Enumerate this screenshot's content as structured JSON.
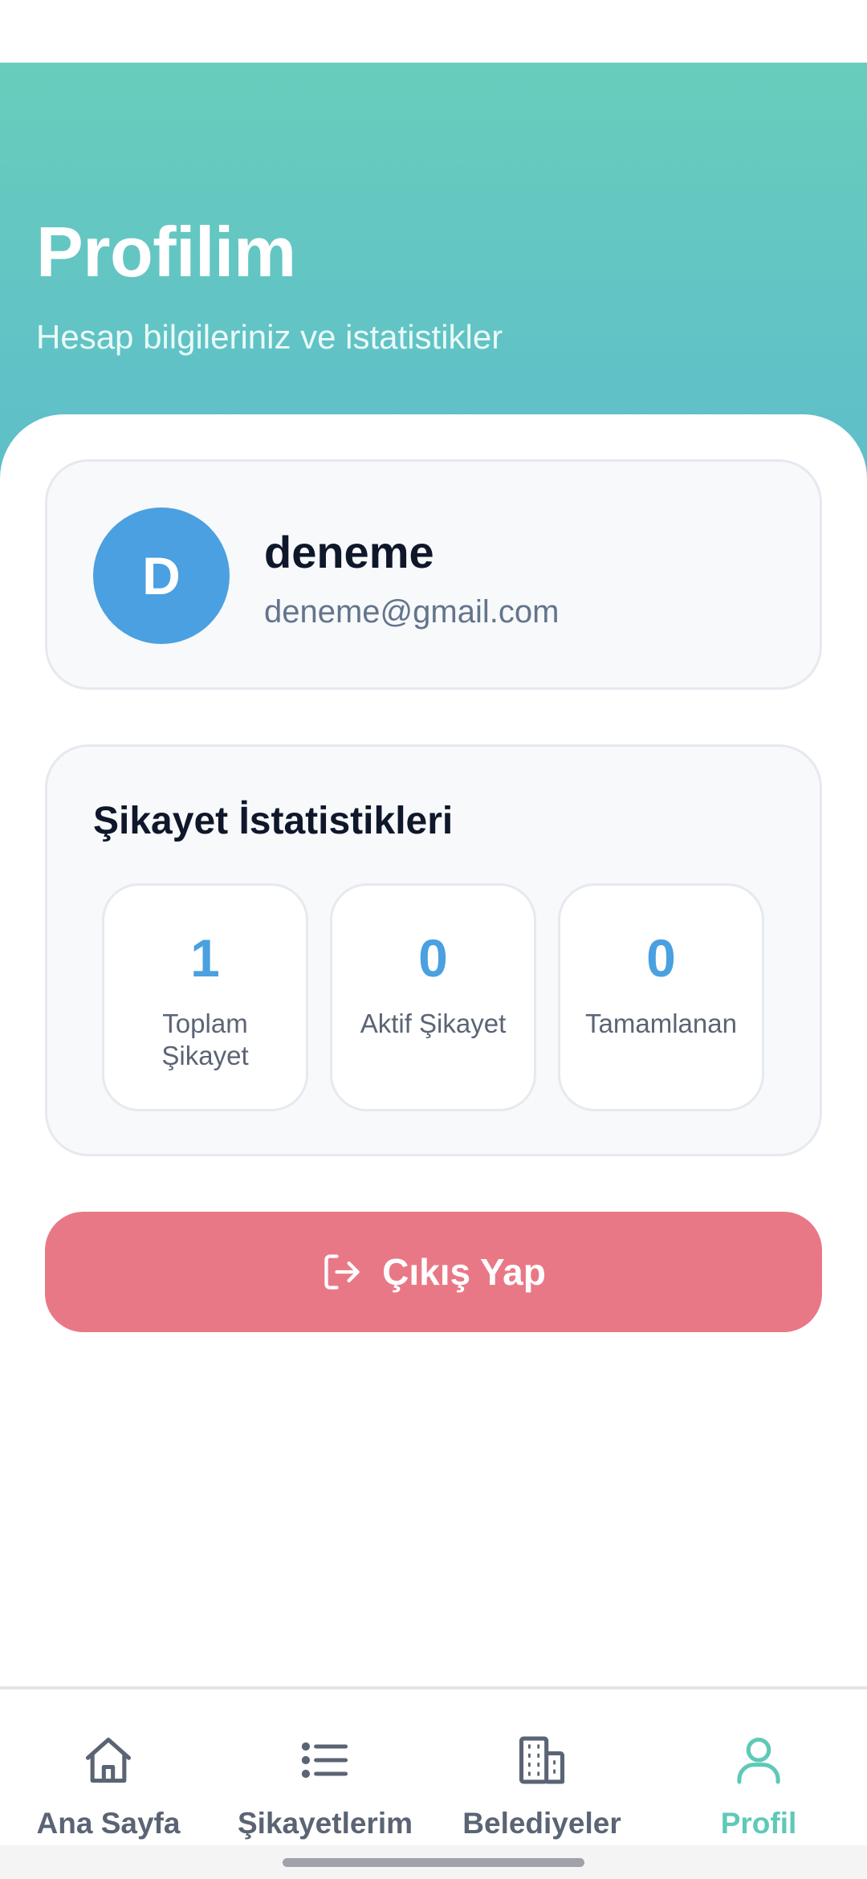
{
  "header": {
    "title": "Profilim",
    "subtitle": "Hesap bilgileriniz ve istatistikler"
  },
  "profile": {
    "avatar_letter": "D",
    "name": "deneme",
    "email": "deneme@gmail.com"
  },
  "stats": {
    "title": "Şikayet İstatistikleri",
    "items": [
      {
        "value": "1",
        "label": "Toplam Şikayet"
      },
      {
        "value": "0",
        "label": "Aktif Şikayet"
      },
      {
        "value": "0",
        "label": "Tamamlanan"
      }
    ]
  },
  "logout": {
    "label": "Çıkış Yap",
    "icon": "logout-icon"
  },
  "tabbar": {
    "items": [
      {
        "label": "Ana Sayfa",
        "icon": "home-icon",
        "active": false
      },
      {
        "label": "Şikayetlerim",
        "icon": "list-icon",
        "active": false
      },
      {
        "label": "Belediyeler",
        "icon": "building-icon",
        "active": false
      },
      {
        "label": "Profil",
        "icon": "user-icon",
        "active": true
      }
    ]
  },
  "colors": {
    "header_gradient_top": "#68cdbc",
    "header_gradient_bottom": "#5dbdcb",
    "accent_blue": "#4aa0e0",
    "logout_red": "#e97886",
    "active_tab": "#5ec9b8"
  }
}
